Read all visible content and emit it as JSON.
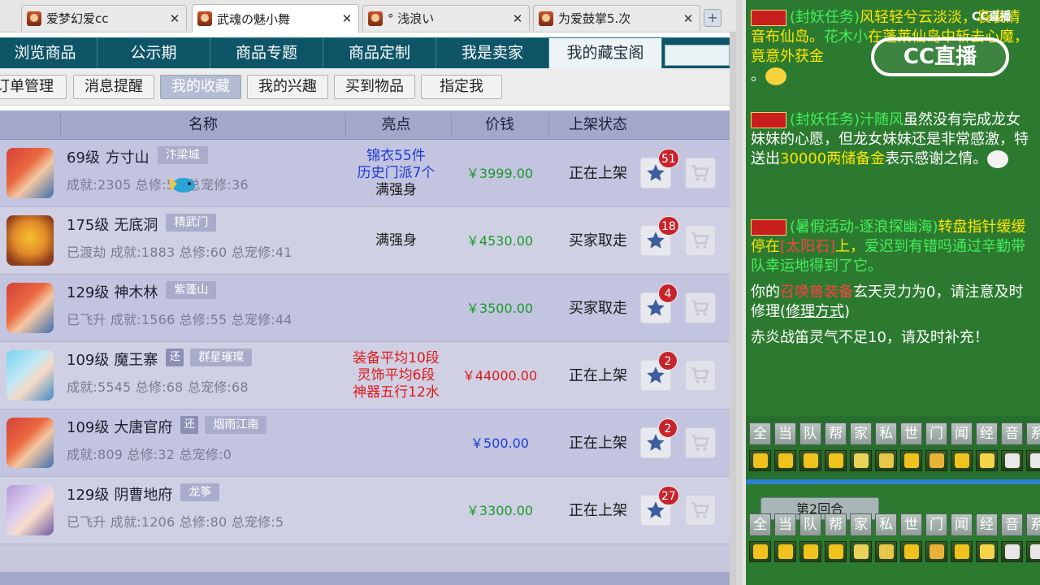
{
  "browser_tabs": [
    {
      "title": "爱梦幻爱cc",
      "active": false
    },
    {
      "title": "武魂の魅小舞",
      "active": true
    },
    {
      "title": "° 浅浪い",
      "active": false
    },
    {
      "title": "为爱鼓掌5.次",
      "active": false
    }
  ],
  "new_tab": "+",
  "nav": {
    "items": [
      "浏览商品",
      "公示期",
      "商品专题",
      "商品定制",
      "我是卖家",
      "我的藏宝阁"
    ],
    "active_index": 5
  },
  "subnav": {
    "items": [
      "订单管理",
      "消息提醒",
      "我的收藏",
      "我的兴趣",
      "买到物品",
      "指定我"
    ],
    "active_index": 2
  },
  "table": {
    "headers": [
      "名称",
      "亮点",
      "价钱",
      "上架状态"
    ],
    "rows": [
      {
        "level": "69级",
        "school": "方寸山",
        "huan": "",
        "server": "汴梁城",
        "stats": "成就:2305 总修:58 总宠修:36",
        "highlights": [
          "锦衣55件",
          "历史门派7个",
          "满强身"
        ],
        "highlight_colors": [
          "blue",
          "blue",
          "dark"
        ],
        "price": "￥3999.00",
        "price_color": "green",
        "status": "正在上架",
        "fav_count": "51",
        "avatar": "red-hair"
      },
      {
        "level": "175级",
        "school": "无底洞",
        "huan": "",
        "server": "精武门",
        "stats": "已渡劫 成就:1883 总修:60 总宠修:41",
        "highlights": [
          "满强身"
        ],
        "highlight_colors": [
          "dark"
        ],
        "price": "￥4530.00",
        "price_color": "green",
        "status": "买家取走",
        "fav_count": "18",
        "avatar": "tiger"
      },
      {
        "level": "129级",
        "school": "神木林",
        "huan": "",
        "server": "紫蓬山",
        "stats": "已飞升 成就:1566 总修:55 总宠修:44",
        "highlights": [],
        "highlight_colors": [],
        "price": "￥3500.00",
        "price_color": "green",
        "status": "买家取走",
        "fav_count": "4",
        "avatar": "red-hair"
      },
      {
        "level": "109级",
        "school": "魔王寨",
        "huan": "还",
        "server": "群星璀璨",
        "stats": "成就:5545 总修:68 总宠修:68",
        "highlights": [
          "装备平均10段",
          "灵饰平均6段",
          "神器五行12水"
        ],
        "highlight_colors": [
          "red",
          "red",
          "red"
        ],
        "price": "￥44000.00",
        "price_color": "red",
        "status": "正在上架",
        "fav_count": "2",
        "avatar": "blue-hair"
      },
      {
        "level": "109级",
        "school": "大唐官府",
        "huan": "还",
        "server": "烟雨江南",
        "stats": "成就:809 总修:32 总宠修:0",
        "highlights": [],
        "highlight_colors": [],
        "price": "￥500.00",
        "price_color": "blue",
        "status": "正在上架",
        "fav_count": "2",
        "avatar": "red-hair"
      },
      {
        "level": "129级",
        "school": "阴曹地府",
        "huan": "",
        "server": "龙筝",
        "stats": "已飞升 成就:1206 总修:80 总宠修:5",
        "highlights": [],
        "highlight_colors": [],
        "price": "￥3300.00",
        "price_color": "green",
        "status": "正在上架",
        "fav_count": "27",
        "avatar": "purple-hair"
      }
    ]
  },
  "chat": {
    "sys_label": "系统",
    "msg1": {
      "a": "(封妖任务)",
      "b": "风轻轻兮云淡淡，袅袅清音布仙岛。",
      "c": "花木小",
      "d": "在蓬莱仙岛中斩去心魔，竟意外获",
      "e": "金",
      "f": "。"
    },
    "msg2": {
      "a": "(封妖任务)",
      "b": "汁随风",
      "c": "虽然没有完成龙女妹妹的心愿，但龙女妹妹还是非常感激，特送出",
      "d": "30000两储备金",
      "e": "表示感谢之情。"
    },
    "msg3": {
      "a": "(暑假活动-逐浪探幽海)",
      "b": "转盘指针缓缓停在",
      "c": "[太阳石]",
      "d": "上，",
      "e": "爱迟到有错吗通过辛勤带队幸运地得到了它。"
    },
    "msg4": {
      "a": "你的",
      "b": "召唤兽装备",
      "c": "玄天灵力为0，请注意及时修理(",
      "d": "修理方式",
      "e": ")"
    },
    "msg5": "赤炎战笛灵气不足10，请及时补充！",
    "channels": [
      "全",
      "当",
      "队",
      "帮",
      "家",
      "私",
      "世",
      "门",
      "闻",
      "经",
      "音",
      "系"
    ],
    "round_tab": "第2回合"
  },
  "watermark": {
    "logo": "CC直播",
    "corner": "CC直播"
  }
}
